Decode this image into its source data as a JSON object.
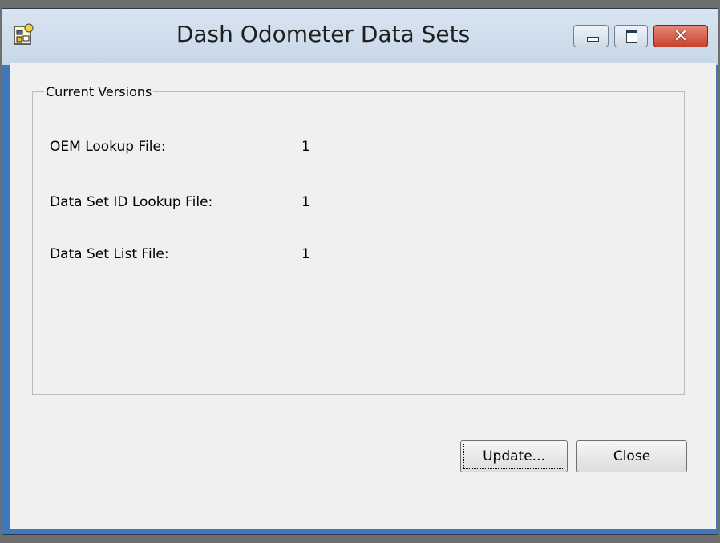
{
  "window": {
    "title": "Dash Odometer Data Sets",
    "controls": {
      "minimize_icon": "minimize-icon",
      "maximize_icon": "maximize-icon",
      "close_icon": "close-icon"
    }
  },
  "group": {
    "legend": "Current Versions",
    "rows": [
      {
        "label": "OEM Lookup File:",
        "value": "1"
      },
      {
        "label": "Data Set ID Lookup File:",
        "value": "1"
      },
      {
        "label": "Data Set List File:",
        "value": "1"
      }
    ]
  },
  "buttons": {
    "update": "Update...",
    "close": "Close"
  },
  "colors": {
    "titlebar": "#c9d9ea",
    "close_button": "#c9412e",
    "client_background": "#f0f0f0"
  }
}
